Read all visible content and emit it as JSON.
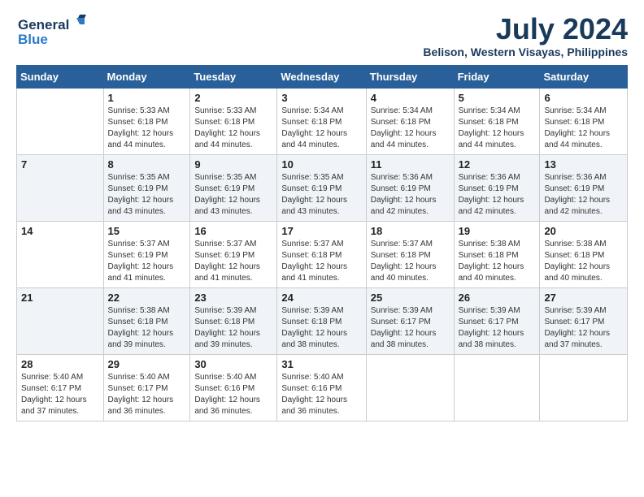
{
  "header": {
    "logo_line1": "General",
    "logo_line2": "Blue",
    "month": "July 2024",
    "location": "Belison, Western Visayas, Philippines"
  },
  "days_of_week": [
    "Sunday",
    "Monday",
    "Tuesday",
    "Wednesday",
    "Thursday",
    "Friday",
    "Saturday"
  ],
  "weeks": [
    [
      {
        "day": "",
        "info": ""
      },
      {
        "day": "1",
        "info": "Sunrise: 5:33 AM\nSunset: 6:18 PM\nDaylight: 12 hours\nand 44 minutes."
      },
      {
        "day": "2",
        "info": "Sunrise: 5:33 AM\nSunset: 6:18 PM\nDaylight: 12 hours\nand 44 minutes."
      },
      {
        "day": "3",
        "info": "Sunrise: 5:34 AM\nSunset: 6:18 PM\nDaylight: 12 hours\nand 44 minutes."
      },
      {
        "day": "4",
        "info": "Sunrise: 5:34 AM\nSunset: 6:18 PM\nDaylight: 12 hours\nand 44 minutes."
      },
      {
        "day": "5",
        "info": "Sunrise: 5:34 AM\nSunset: 6:18 PM\nDaylight: 12 hours\nand 44 minutes."
      },
      {
        "day": "6",
        "info": "Sunrise: 5:34 AM\nSunset: 6:18 PM\nDaylight: 12 hours\nand 44 minutes."
      }
    ],
    [
      {
        "day": "7",
        "info": ""
      },
      {
        "day": "8",
        "info": "Sunrise: 5:35 AM\nSunset: 6:19 PM\nDaylight: 12 hours\nand 43 minutes."
      },
      {
        "day": "9",
        "info": "Sunrise: 5:35 AM\nSunset: 6:19 PM\nDaylight: 12 hours\nand 43 minutes."
      },
      {
        "day": "10",
        "info": "Sunrise: 5:35 AM\nSunset: 6:19 PM\nDaylight: 12 hours\nand 43 minutes."
      },
      {
        "day": "11",
        "info": "Sunrise: 5:36 AM\nSunset: 6:19 PM\nDaylight: 12 hours\nand 42 minutes."
      },
      {
        "day": "12",
        "info": "Sunrise: 5:36 AM\nSunset: 6:19 PM\nDaylight: 12 hours\nand 42 minutes."
      },
      {
        "day": "13",
        "info": "Sunrise: 5:36 AM\nSunset: 6:19 PM\nDaylight: 12 hours\nand 42 minutes."
      }
    ],
    [
      {
        "day": "14",
        "info": ""
      },
      {
        "day": "15",
        "info": "Sunrise: 5:37 AM\nSunset: 6:19 PM\nDaylight: 12 hours\nand 41 minutes."
      },
      {
        "day": "16",
        "info": "Sunrise: 5:37 AM\nSunset: 6:19 PM\nDaylight: 12 hours\nand 41 minutes."
      },
      {
        "day": "17",
        "info": "Sunrise: 5:37 AM\nSunset: 6:18 PM\nDaylight: 12 hours\nand 41 minutes."
      },
      {
        "day": "18",
        "info": "Sunrise: 5:37 AM\nSunset: 6:18 PM\nDaylight: 12 hours\nand 40 minutes."
      },
      {
        "day": "19",
        "info": "Sunrise: 5:38 AM\nSunset: 6:18 PM\nDaylight: 12 hours\nand 40 minutes."
      },
      {
        "day": "20",
        "info": "Sunrise: 5:38 AM\nSunset: 6:18 PM\nDaylight: 12 hours\nand 40 minutes."
      }
    ],
    [
      {
        "day": "21",
        "info": ""
      },
      {
        "day": "22",
        "info": "Sunrise: 5:38 AM\nSunset: 6:18 PM\nDaylight: 12 hours\nand 39 minutes."
      },
      {
        "day": "23",
        "info": "Sunrise: 5:39 AM\nSunset: 6:18 PM\nDaylight: 12 hours\nand 39 minutes."
      },
      {
        "day": "24",
        "info": "Sunrise: 5:39 AM\nSunset: 6:18 PM\nDaylight: 12 hours\nand 38 minutes."
      },
      {
        "day": "25",
        "info": "Sunrise: 5:39 AM\nSunset: 6:17 PM\nDaylight: 12 hours\nand 38 minutes."
      },
      {
        "day": "26",
        "info": "Sunrise: 5:39 AM\nSunset: 6:17 PM\nDaylight: 12 hours\nand 38 minutes."
      },
      {
        "day": "27",
        "info": "Sunrise: 5:39 AM\nSunset: 6:17 PM\nDaylight: 12 hours\nand 37 minutes."
      }
    ],
    [
      {
        "day": "28",
        "info": "Sunrise: 5:40 AM\nSunset: 6:17 PM\nDaylight: 12 hours\nand 37 minutes."
      },
      {
        "day": "29",
        "info": "Sunrise: 5:40 AM\nSunset: 6:17 PM\nDaylight: 12 hours\nand 36 minutes."
      },
      {
        "day": "30",
        "info": "Sunrise: 5:40 AM\nSunset: 6:16 PM\nDaylight: 12 hours\nand 36 minutes."
      },
      {
        "day": "31",
        "info": "Sunrise: 5:40 AM\nSunset: 6:16 PM\nDaylight: 12 hours\nand 36 minutes."
      },
      {
        "day": "",
        "info": ""
      },
      {
        "day": "",
        "info": ""
      },
      {
        "day": "",
        "info": ""
      }
    ]
  ],
  "week_row_styles": [
    "row-white",
    "row-shaded",
    "row-white",
    "row-shaded",
    "row-white"
  ]
}
